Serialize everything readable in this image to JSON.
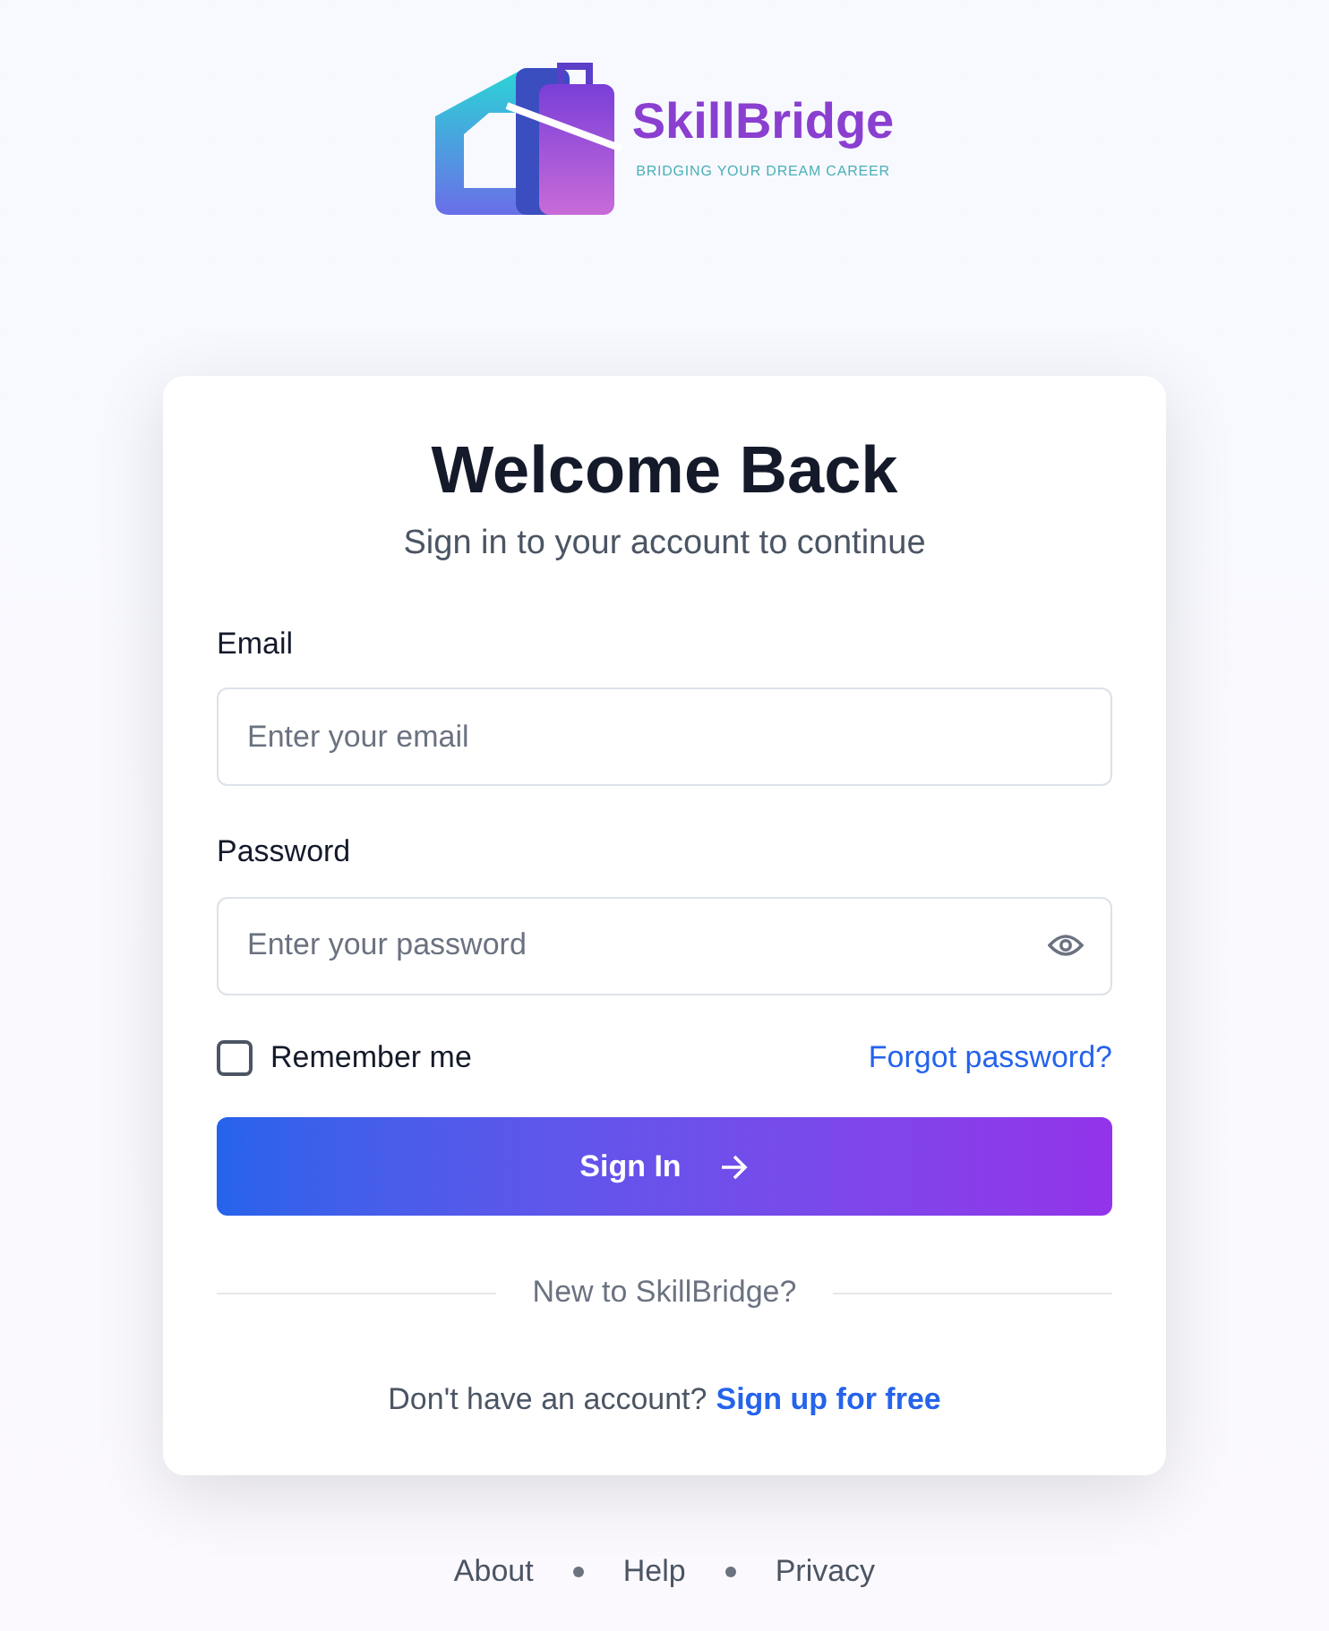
{
  "logo": {
    "name": "SkillBridge",
    "tagline": "BRIDGING YOUR DREAM CAREER"
  },
  "card": {
    "title": "Welcome Back",
    "subtitle": "Sign in to your account to continue",
    "fields": [
      {
        "label": "Email",
        "placeholder": "Enter your email",
        "kind": "email"
      },
      {
        "label": "Password",
        "placeholder": "Enter your password",
        "kind": "password"
      }
    ],
    "remember": {
      "label": "Remember me",
      "checked": false
    },
    "forgot_link": "Forgot password?",
    "submit": "Sign In",
    "divider_text": "New to SkillBridge?",
    "signup_prompt": "Don't have an account?",
    "signup_link": "Sign up for free"
  },
  "footer": [
    "About",
    "Help",
    "Privacy"
  ]
}
